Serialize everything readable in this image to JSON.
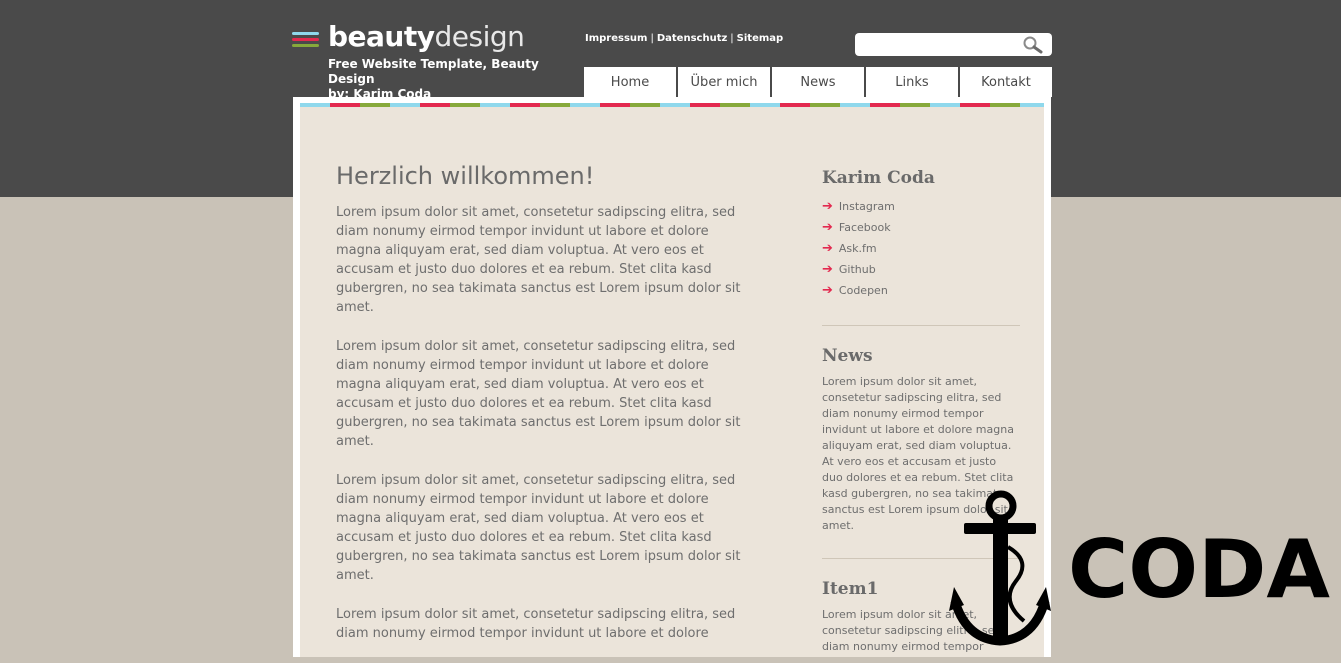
{
  "colors": {
    "dark": "#4a4a4a",
    "beige": "#c9c2b7",
    "panel": "#ebe4da",
    "accent_red": "#e3294f",
    "accent_blue": "#8fd8ec",
    "accent_green": "#87a93b"
  },
  "logo": {
    "word_bold": "beauty",
    "word_light": "design",
    "icon": "color-lines-icon"
  },
  "tagline": {
    "line1": "Free Website Template, Beauty Design",
    "line2": "by: Karim Coda"
  },
  "toplinks": [
    "Impressum",
    "Datenschutz",
    "Sitemap"
  ],
  "toplinks_sep": "|",
  "search": {
    "value": "",
    "placeholder": "",
    "icon": "search-icon"
  },
  "nav": [
    "Home",
    "Über mich",
    "News",
    "Links",
    "Kontakt"
  ],
  "main": {
    "title": "Herzlich willkommen!",
    "paragraphs": [
      "Lorem ipsum dolor sit amet, consetetur sadipscing elitra, sed diam nonumy eirmod tempor invidunt ut labore et dolore magna aliquyam erat, sed diam voluptua. At vero eos et accusam et justo duo dolores et ea rebum. Stet clita kasd gubergren, no sea takimata sanctus est Lorem ipsum dolor sit amet.",
      "Lorem ipsum dolor sit amet, consetetur sadipscing elitra, sed diam nonumy eirmod tempor invidunt ut labore et dolore magna aliquyam erat, sed diam voluptua. At vero eos et accusam et justo duo dolores et ea rebum. Stet clita kasd gubergren, no sea takimata sanctus est Lorem ipsum dolor sit amet.",
      "Lorem ipsum dolor sit amet, consetetur sadipscing elitra, sed diam nonumy eirmod tempor invidunt ut labore et dolore magna aliquyam erat, sed diam voluptua. At vero eos et accusam et justo duo dolores et ea rebum. Stet clita kasd gubergren, no sea takimata sanctus est Lorem ipsum dolor sit amet.",
      "Lorem ipsum dolor sit amet, consetetur sadipscing elitra, sed diam nonumy eirmod tempor invidunt ut labore et dolore"
    ]
  },
  "sidebar": {
    "profile_title": "Karim Coda",
    "links": [
      "Instagram",
      "Facebook",
      "Ask.fm",
      "Github",
      "Codepen"
    ],
    "news_title": "News",
    "news_text": "Lorem ipsum dolor sit amet, consetetur sadipscing elitra, sed diam nonumy eirmod tempor invidunt ut labore et dolore magna aliquyam erat, sed diam voluptua. At vero eos et accusam et justo duo dolores et ea rebum. Stet clita kasd gubergren, no sea takimata sanctus est Lorem ipsum dolor sit amet.",
    "item1_title": "Item1",
    "item1_text": "Lorem ipsum dolor sit amet, consetetur sadipscing elitra, sed diam nonumy eirmod tempor"
  },
  "watermark": {
    "text": "CODA",
    "icon": "anchor-icon"
  }
}
